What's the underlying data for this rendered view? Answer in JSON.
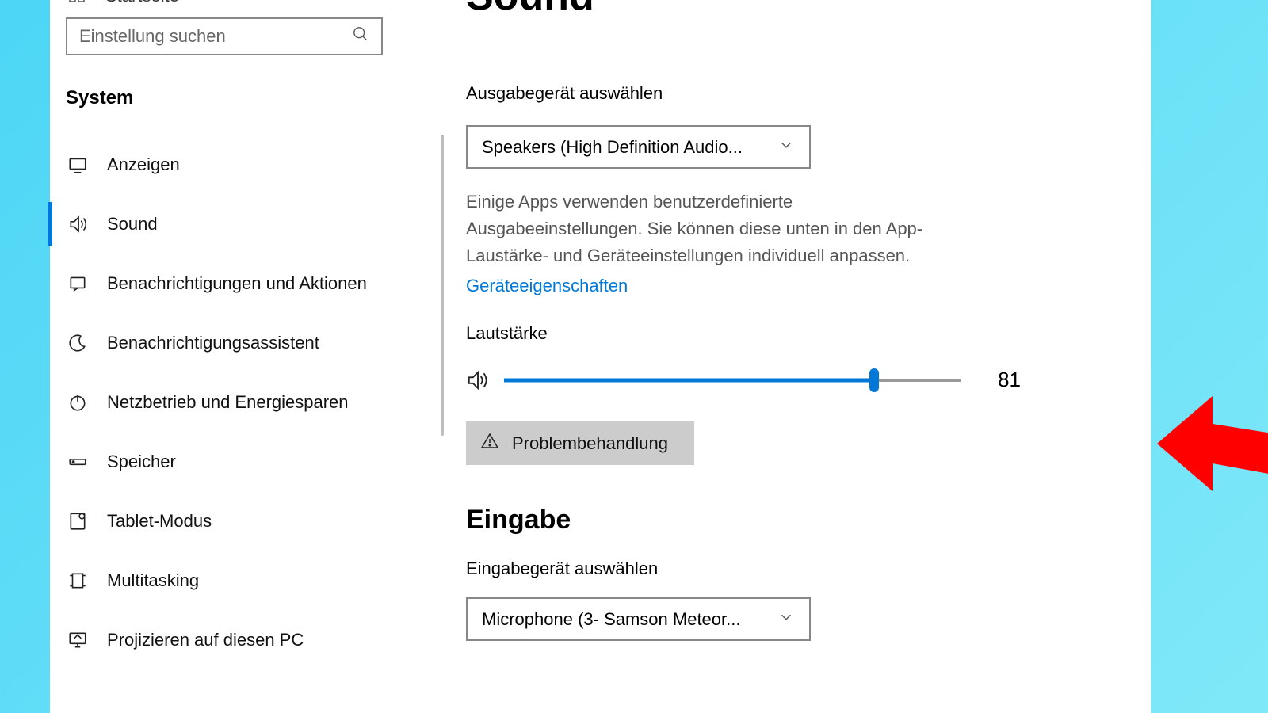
{
  "page_title": "Sound",
  "sidebar": {
    "home_label": "Startseite",
    "search_placeholder": "Einstellung suchen",
    "section_title": "System",
    "items": [
      {
        "label": "Anzeigen",
        "active": false
      },
      {
        "label": "Sound",
        "active": true
      },
      {
        "label": "Benachrichtigungen und Aktionen",
        "active": false
      },
      {
        "label": "Benachrichtigungsassistent",
        "active": false
      },
      {
        "label": "Netzbetrieb und Energiesparen",
        "active": false
      },
      {
        "label": "Speicher",
        "active": false
      },
      {
        "label": "Tablet-Modus",
        "active": false
      },
      {
        "label": "Multitasking",
        "active": false
      },
      {
        "label": "Projizieren auf diesen PC",
        "active": false
      }
    ]
  },
  "output": {
    "section_label": "Ausgabegerät auswählen",
    "selected": "Speakers (High Definition Audio...",
    "description": "Einige Apps verwenden benutzerdefinierte Ausgabeeinstellungen. Sie können diese unten in den App-Laustärke- und Geräteeinstellungen individuell anpassen.",
    "properties_link": "Geräteeigenschaften",
    "volume_label": "Lautstärke",
    "volume_value": "81",
    "troubleshoot_label": "Problembehandlung"
  },
  "input_section": {
    "heading": "Eingabe",
    "section_label": "Eingabegerät auswählen",
    "selected": "Microphone (3- Samson Meteor..."
  }
}
